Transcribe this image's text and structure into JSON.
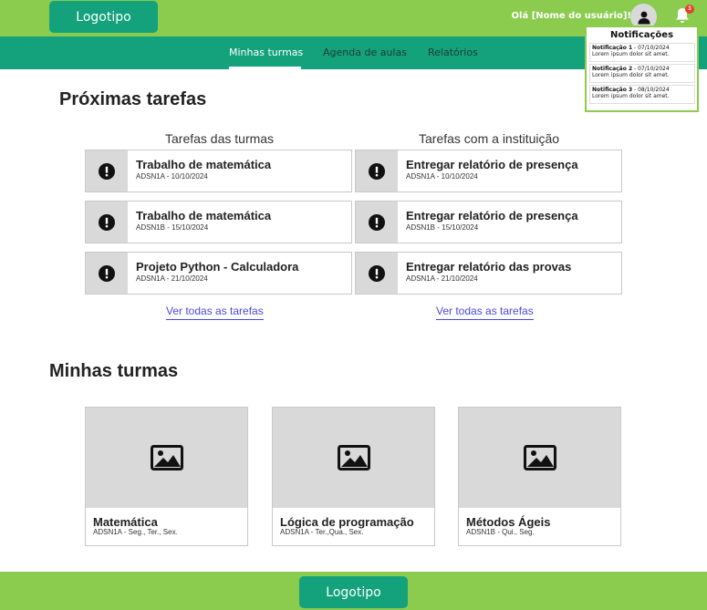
{
  "header": {
    "logo": "Logotipo",
    "greeting": "Olá [Nome do usuário]!",
    "notification_count": "3"
  },
  "nav": {
    "items": [
      {
        "label": "Minhas turmas"
      },
      {
        "label": "Agenda de aulas"
      },
      {
        "label": "Relatórios"
      }
    ],
    "active_index": 0
  },
  "notifications": {
    "title": "Notificações",
    "items": [
      {
        "title": "Notificação 1",
        "date": " - 07/10/2024",
        "text": "Lorem ipsum dolor sit amet."
      },
      {
        "title": "Notificação 2",
        "date": " - 07/10/2024",
        "text": "Lorem ipsum dolor sit amet."
      },
      {
        "title": "Notificação 3",
        "date": " - 08/10/2024",
        "text": "Lorem ipsum dolor sit amet."
      }
    ]
  },
  "tasks": {
    "title": "Próximas tarefas",
    "classes": {
      "title": "Tarefas das turmas",
      "items": [
        {
          "title": "Trabalho de matemática",
          "sub": "ADSN1A - 10/10/2024"
        },
        {
          "title": "Trabalho de matemática",
          "sub": "ADSN1B - 15/10/2024"
        },
        {
          "title": "Projeto Python - Calculadora",
          "sub": "ADSN1A - 21/10/2024"
        }
      ],
      "link": "Ver todas as tarefas"
    },
    "institution": {
      "title": "Tarefas com a instituição",
      "items": [
        {
          "title": "Entregar relatório de presença",
          "sub": "ADSN1A - 10/10/2024"
        },
        {
          "title": "Entregar relatório de presença",
          "sub": "ADSN1B - 15/10/2024"
        },
        {
          "title": "Entregar relatório das provas",
          "sub": "ADSN1A - 21/10/2024"
        }
      ],
      "link": "Ver todas as tarefas"
    }
  },
  "classes": {
    "title": "Minhas turmas",
    "items": [
      {
        "title": "Matemática",
        "sub": "ADSN1A - Seg., Ter., Sex."
      },
      {
        "title": "Lógica de programação",
        "sub": "ADSN1A - Ter.,Qua., Sex."
      },
      {
        "title": "Métodos Ágeis",
        "sub": "ADSN1B - Qui., Seg."
      }
    ]
  },
  "footer": {
    "logo": "Logotipo"
  },
  "colors": {
    "header_green": "#8bcb4e",
    "nav_teal": "#13a27c",
    "link_blue": "#4b4bd8",
    "badge_red": "#e8402a",
    "placeholder_gray": "#d9d9d9"
  },
  "icons": [
    "user-avatar-icon",
    "bell-icon",
    "alert-icon",
    "image-placeholder-icon"
  ]
}
